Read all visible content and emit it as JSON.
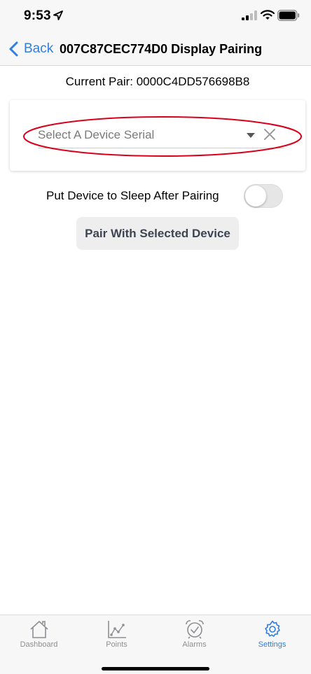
{
  "status_bar": {
    "time": "9:53",
    "icons": [
      "location-arrow-icon",
      "cellular-signal-icon",
      "wifi-icon",
      "battery-icon"
    ]
  },
  "nav": {
    "back_label": "Back",
    "title": "007C87CEC774D0 Display Pairing"
  },
  "main": {
    "current_pair_label": "Current Pair: 0000C4DD576698B8",
    "device_select": {
      "placeholder": "Select A Device Serial",
      "highlight_color": "#d9001b"
    },
    "sleep_toggle": {
      "label": "Put Device to Sleep After Pairing",
      "checked": false
    },
    "pair_button_label": "Pair With Selected Device"
  },
  "tabs": [
    {
      "label": "Dashboard",
      "icon": "house-icon",
      "active": false
    },
    {
      "label": "Points",
      "icon": "chart-points-icon",
      "active": false
    },
    {
      "label": "Alarms",
      "icon": "alarm-clock-icon",
      "active": false
    },
    {
      "label": "Settings",
      "icon": "gear-icon",
      "active": true
    }
  ],
  "colors": {
    "accent": "#2f7ee0",
    "inactive_tab": "#8e8e93"
  }
}
